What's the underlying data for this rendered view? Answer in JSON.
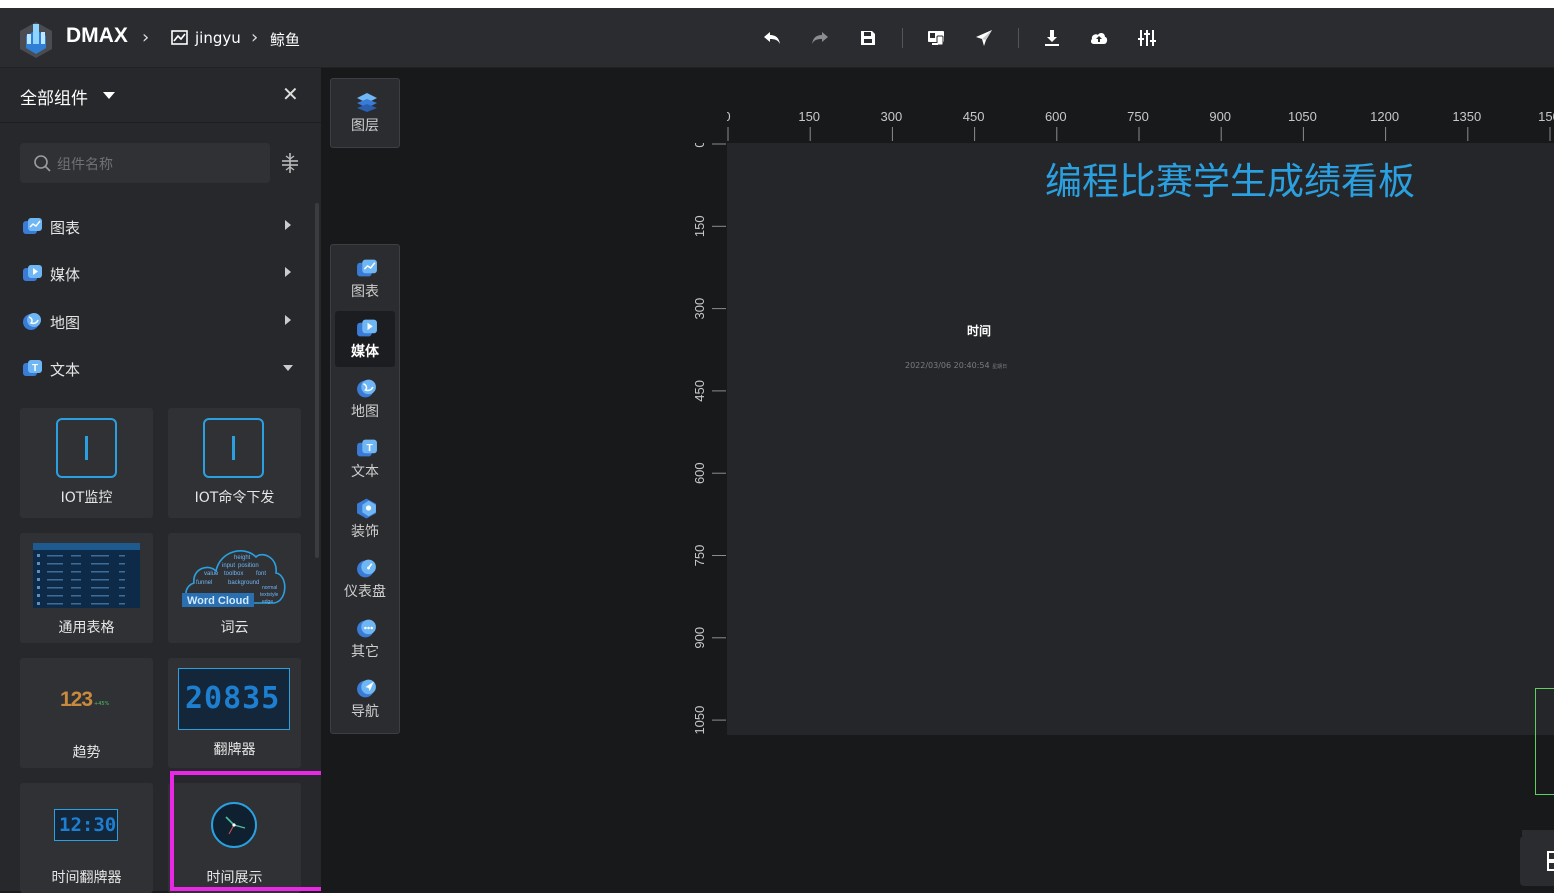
{
  "header": {
    "brand": "DMAX",
    "breadcrumbs": [
      "jingyu",
      "鲸鱼"
    ],
    "toolbar": [
      "undo-icon",
      "redo-icon",
      "save-icon",
      "preview-icon",
      "publish-icon",
      "download-icon",
      "upload-icon",
      "settings-sliders-icon"
    ]
  },
  "left_panel": {
    "title": "全部组件",
    "search_placeholder": "组件名称",
    "categories": [
      {
        "label": "图表",
        "expanded": false
      },
      {
        "label": "媒体",
        "expanded": false
      },
      {
        "label": "地图",
        "expanded": false
      },
      {
        "label": "文本",
        "expanded": true
      }
    ],
    "components": [
      {
        "label": "IOT监控"
      },
      {
        "label": "IOT命令下发"
      },
      {
        "label": "通用表格"
      },
      {
        "label": "词云"
      },
      {
        "label": "趋势"
      },
      {
        "label": "翻牌器"
      },
      {
        "label": "时间翻牌器"
      },
      {
        "label": "时间展示"
      }
    ],
    "thumbs": {
      "trend_value": "123",
      "trend_delta": "+45%",
      "flip_digits": "20835",
      "time_flip": "12:30",
      "wordcloud_main": "Word Cloud",
      "wordcloud_words": [
        "height",
        "input",
        "position",
        "value",
        "toolbox",
        "font",
        "funnel",
        "background",
        "normal",
        "textstyle",
        "edge"
      ]
    }
  },
  "vertical_bar": {
    "layers_label": "图层",
    "items": [
      {
        "label": "图表"
      },
      {
        "label": "媒体",
        "active": true
      },
      {
        "label": "地图"
      },
      {
        "label": "文本"
      },
      {
        "label": "装饰"
      },
      {
        "label": "仪表盘"
      },
      {
        "label": "其它"
      },
      {
        "label": "导航"
      }
    ]
  },
  "rulers": {
    "horizontal": [
      "0",
      "150",
      "300",
      "450",
      "600",
      "750",
      "900",
      "1050",
      "1200",
      "1350",
      "150"
    ],
    "vertical": [
      "0",
      "150",
      "300",
      "450",
      "600",
      "750",
      "900",
      "1050"
    ]
  },
  "canvas": {
    "title": "编程比赛学生成绩看板",
    "time_label": "时间",
    "time_value": "2022/03/06 20:40:54",
    "weekday": "星期日"
  },
  "colors": {
    "accent": "#2aa0e0",
    "highlight": "#ea27e6",
    "panel": "#27282b",
    "topbar": "#2b2c2f"
  }
}
